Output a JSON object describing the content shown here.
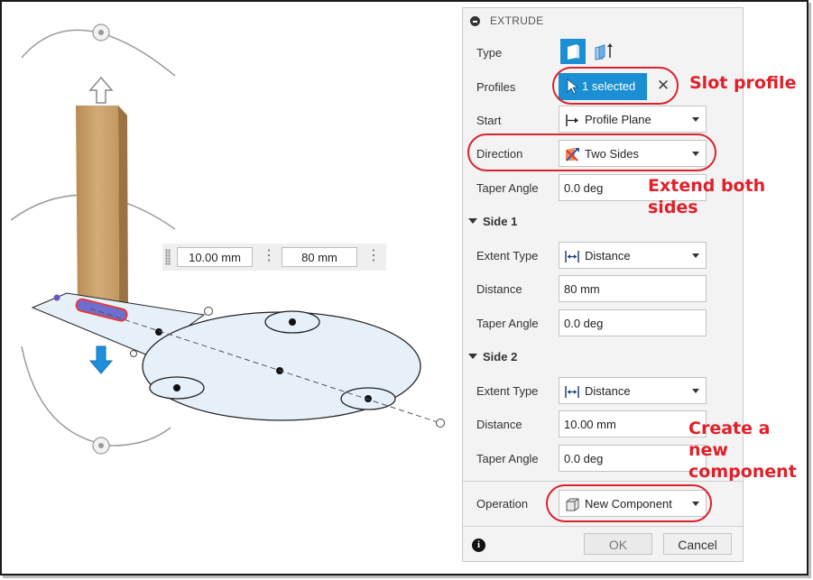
{
  "viewport": {
    "measure_width": "10.00 mm",
    "measure_distance": "80 mm"
  },
  "panel": {
    "title": "EXTRUDE",
    "type_label": "Type",
    "profiles_label": "Profiles",
    "profiles_value": "1 selected",
    "start_label": "Start",
    "start_value": "Profile Plane",
    "direction_label": "Direction",
    "direction_value": "Two Sides",
    "taper_label": "Taper Angle",
    "taper_value": "0.0 deg",
    "side1": {
      "heading": "Side 1",
      "extent_label": "Extent Type",
      "extent_value": "Distance",
      "distance_label": "Distance",
      "distance_value": "80 mm",
      "taper_label": "Taper Angle",
      "taper_value": "0.0 deg"
    },
    "side2": {
      "heading": "Side 2",
      "extent_label": "Extent Type",
      "extent_value": "Distance",
      "distance_label": "Distance",
      "distance_value": "10.00 mm",
      "taper_label": "Taper Angle",
      "taper_value": "0.0 deg"
    },
    "operation_label": "Operation",
    "operation_value": "New Component",
    "ok_label": "OK",
    "cancel_label": "Cancel",
    "info_glyph": "i"
  },
  "annotations": {
    "slot_profile": "Slot profile",
    "extend_line1": "Extend both",
    "extend_line2": "sides",
    "create_line1": "Create a",
    "create_line2": "new",
    "create_line3": "component"
  },
  "colors": {
    "accent": "#1b8fd4",
    "annotation": "#e0202a",
    "wood": "#c9a26b",
    "sketch_fill": "#e6f0f8"
  }
}
